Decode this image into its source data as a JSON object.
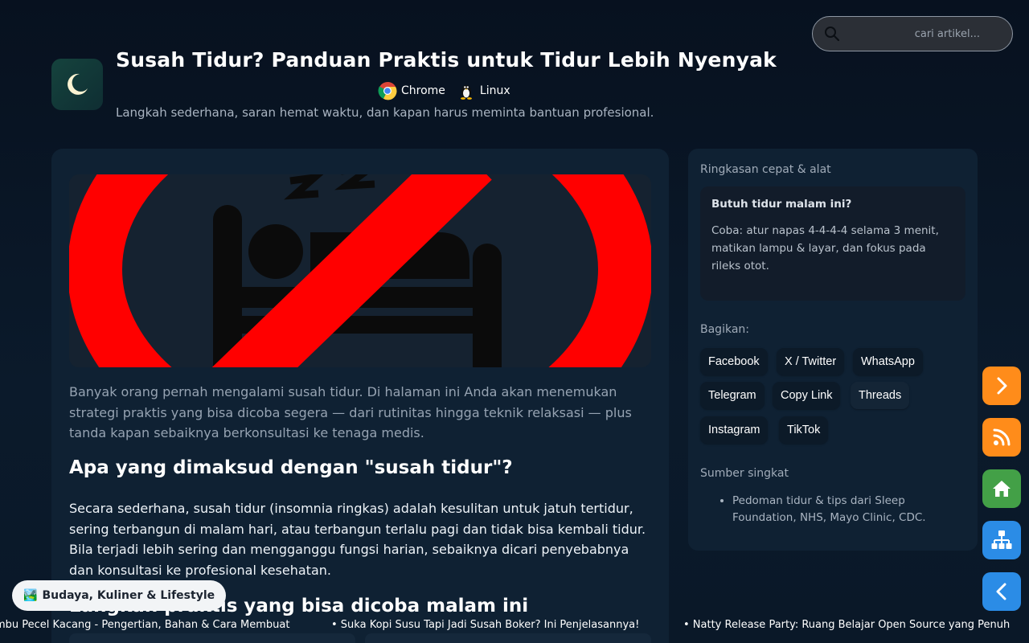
{
  "search": {
    "placeholder": "cari artikel..."
  },
  "header": {
    "title": "Susah Tidur? Panduan Praktis untuk Tidur Lebih Nyenyak",
    "platforms": [
      "Chrome",
      "Linux"
    ],
    "subtitle": "Langkah sederhana, saran hemat waktu, dan kapan harus meminta bantuan profesional."
  },
  "article": {
    "intro": "Banyak orang pernah mengalami susah tidur. Di halaman ini Anda akan menemukan strategi praktis yang bisa dicoba segera — dari rutinitas hingga teknik relaksasi — plus tanda kapan sebaiknya berkonsultasi ke tenaga medis.",
    "h2_definition": "Apa yang dimaksud dengan \"susah tidur\"?",
    "definition": "Secara sederhana, susah tidur (insomnia ringkas) adalah kesulitan untuk jatuh tertidur, sering terbangun di malam hari, atau terbangun terlalu pagi dan tidak bisa kembali tidur. Bila terjadi lebih sering dan mengganggu fungsi harian, sebaiknya dicari penyebabnya dan konsultasi ke profesional kesehatan.",
    "h2_steps": "Langkah praktis yang bisa dicoba malam ini"
  },
  "sidebar": {
    "summary_label": "Ringkasan cepat & alat",
    "tip_title": "Butuh tidur malam ini?",
    "tip_text": "Coba: atur napas 4-4-4-4 selama 3 menit, matikan lampu & layar, dan fokus pada rileks otot.",
    "share_label": "Bagikan:",
    "share": [
      "Facebook",
      "X / Twitter",
      "WhatsApp",
      "Telegram",
      "Copy Link",
      "Threads",
      "Instagram",
      "TikTok"
    ],
    "sources_label": "Sumber singkat",
    "sources": [
      "Pedoman tidur & tips dari Sleep Foundation, NHS, Mayo Clinic, CDC."
    ]
  },
  "category": {
    "icon": "🏞️",
    "label": "Budaya, Kuliner & Lifestyle"
  },
  "ticker": [
    "mbu Pecel Kacang - Pengertian, Bahan & Cara Membuat",
    "• Suka Kopi Susu Tapi Jadi Susah Boker? Ini Penjelasannya!",
    "• Natty Release Party: Ruang Belajar Open Source yang Penuh"
  ],
  "floating_buttons": [
    "chevron-right-icon",
    "rss-icon",
    "home-icon",
    "sitemap-icon",
    "chevron-left-icon"
  ],
  "colors": {
    "orange": "#ff8c1a",
    "green": "#43a047",
    "blue": "#2b8ce6",
    "red": "#ff0000"
  }
}
